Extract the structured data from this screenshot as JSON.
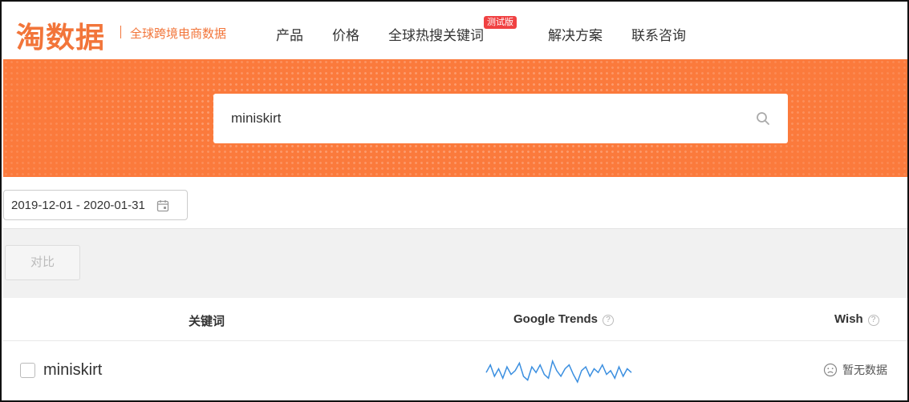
{
  "header": {
    "logo": "淘数据",
    "tagline": "全球跨境电商数据",
    "nav": [
      {
        "label": "产品"
      },
      {
        "label": "价格"
      },
      {
        "label": "全球热搜关键词",
        "badge": "测试版"
      },
      {
        "label": "解决方案"
      },
      {
        "label": "联系咨询"
      }
    ]
  },
  "search": {
    "value": "miniskirt",
    "icon": "search-icon"
  },
  "date_range": {
    "text": "2019-12-01 - 2020-01-31",
    "icon": "calendar-icon"
  },
  "compare": {
    "label": "对比"
  },
  "table": {
    "columns": {
      "keyword": "关键词",
      "google_trends": "Google Trends",
      "wish": "Wish"
    },
    "help_glyph": "?",
    "rows": [
      {
        "keyword": "miniskirt",
        "trend": [
          8,
          12,
          6,
          10,
          5,
          11,
          7,
          9,
          13,
          6,
          4,
          11,
          8,
          12,
          7,
          5,
          14,
          9,
          6,
          10,
          12,
          7,
          3,
          9,
          11,
          6,
          10,
          8,
          12,
          7,
          9,
          5,
          11,
          6,
          10,
          8
        ],
        "wish": "暂无数据"
      }
    ]
  },
  "colors": {
    "brand": "#f2753a",
    "banner": "#fb7a3c",
    "badge": "#f04142",
    "trend_line": "#3b8fe0"
  }
}
